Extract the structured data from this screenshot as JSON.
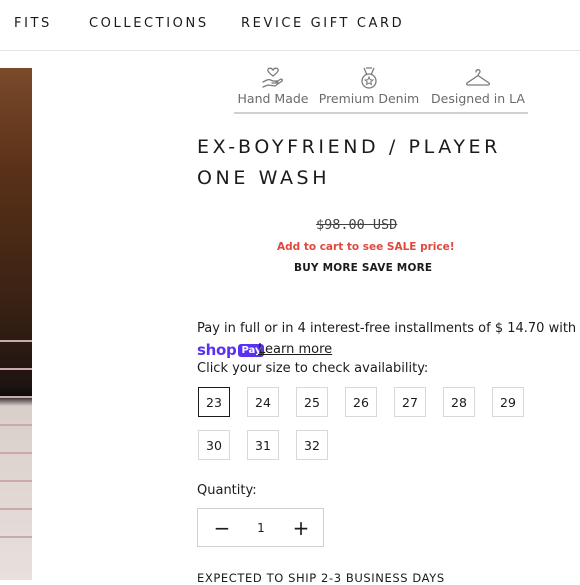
{
  "nav": {
    "items": [
      "FITS",
      "COLLECTIONS",
      "REVICE GIFT CARD"
    ]
  },
  "badges": [
    {
      "label": "Hand Made",
      "icon": "hand-heart-icon"
    },
    {
      "label": "Premium Denim",
      "icon": "medal-icon"
    },
    {
      "label": "Designed in LA",
      "icon": "hanger-icon"
    }
  ],
  "product": {
    "title": "EX-BOYFRIEND / PLAYER ONE WASH",
    "price": "$98.00 USD",
    "sale_note": "Add to cart to see SALE price!",
    "promo": "BUY MORE SAVE MORE"
  },
  "payment": {
    "installments_text": "Pay in full or in 4 interest-free installments of $ 14.70 with",
    "shop_word": "shop",
    "pay_chip": "Pay",
    "learn_more": "Learn more"
  },
  "sizes": {
    "prompt": "Click your size to check availability:",
    "options": [
      "23",
      "24",
      "25",
      "26",
      "27",
      "28",
      "29",
      "30",
      "31",
      "32"
    ],
    "selected": "23"
  },
  "quantity": {
    "label": "Quantity:",
    "value": "1",
    "minus": "−",
    "plus": "+"
  },
  "shipping": {
    "text": "EXPECTED TO SHIP 2-3 BUSINESS DAYS"
  }
}
